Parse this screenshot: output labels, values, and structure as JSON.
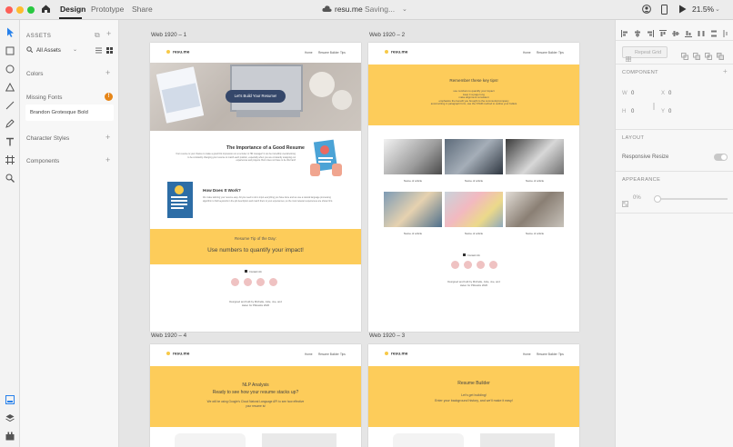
{
  "app": {
    "tabs": [
      "Design",
      "Prototype",
      "Share"
    ],
    "doc_title": "resu.me",
    "status": "Saving...",
    "zoom": "21.5%"
  },
  "assets": {
    "title": "ASSETS",
    "filter": "All Assets",
    "colors": "Colors",
    "missing_fonts": "Missing Fonts",
    "missing_font_name": "Brandon Grotesque Bold",
    "character_styles": "Character Styles",
    "components": "Components"
  },
  "artboards": [
    {
      "label": "Web 1920 – 1"
    },
    {
      "label": "Web 1920 – 2"
    },
    {
      "label": "Web 1920 – 4"
    },
    {
      "label": "Web 1920 – 3"
    }
  ],
  "site": {
    "logo": "resu.me",
    "nav": [
      "Home",
      "Resume Builder",
      "Tips"
    ],
    "hero_button": "Let's Build Your Resume!",
    "importance_title": "The Importance of a Good Resume",
    "importance_body": "Your resume is your chance to make a good first impression on a recruiter or HR manager! It can be incredibly overwhelming to be constantly changing your resume to match each position, especially when you are constantly swapping out experiences and projects. But it does not have to be this hard!",
    "how_title": "How Does It Work?",
    "how_body": "We make tailoring your resume easy. All you need to do is input everything you have done and we use a natural language processing algorithm to find keywords in the job description and match them to your experiences, so the most relevant experiences are shown first.",
    "tip_label": "Resume Tip of the Day:",
    "tip_text": "Use numbers to quantify your impact!",
    "contact": "Contact info",
    "credit": "Designed and built by Michelle, Julie, Joe, and Helen for PitHacks 2020",
    "tips_title": "Remember these key tips!",
    "tips_list": [
      "use numbers to quantify your impact",
      "keep it a page long",
      "make alignment consistent",
      "emphasize the benefit you brought to the community/company",
      "avoid writing in paragraph form, use the STAR method to outline your bullets"
    ],
    "article_caption": "Name of article",
    "nlp_title": "NLP Analysis",
    "nlp_sub": "Ready to see how your resume stacks up?",
    "nlp_body": "We will be using Google's Cloud Natural Language API to see how effective your resume is!",
    "builder_title": "Resume Builder",
    "builder_sub": "Let's get building!",
    "builder_body": "Enter your background history, and we'll make it easy!"
  },
  "right": {
    "repeat_grid": "Repeat Grid",
    "component": "COMPONENT",
    "w_label": "W",
    "w_value": "0",
    "x_label": "X",
    "x_value": "0",
    "h_label": "H",
    "h_value": "0",
    "y_label": "Y",
    "y_value": "0",
    "layout": "LAYOUT",
    "responsive_resize": "Responsive Resize",
    "appearance": "APPEARANCE",
    "opacity": "0%"
  },
  "colors": {
    "accent": "#fdcc5a",
    "pink": "#efc2c2",
    "toolbar_blue": "#2680eb",
    "warning": "#e68619"
  }
}
